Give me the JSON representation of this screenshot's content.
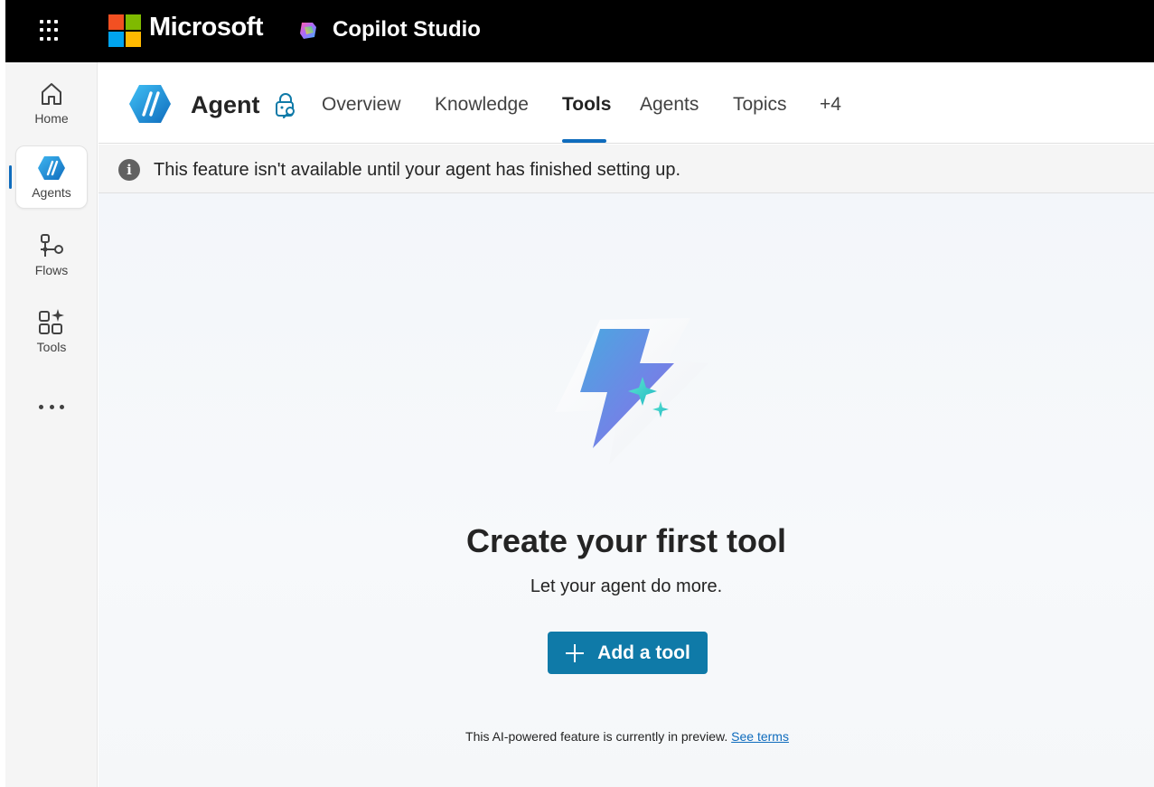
{
  "topbar": {
    "brand": "Microsoft",
    "product": "Copilot Studio",
    "waffle_icon": "app-launcher-icon",
    "brand_colors": [
      "#f25022",
      "#7fba00",
      "#00a4ef",
      "#ffb900"
    ]
  },
  "rail": {
    "items": [
      {
        "label": "Home",
        "icon": "home-icon"
      },
      {
        "label": "Agents",
        "icon": "agents-icon",
        "active": true
      },
      {
        "label": "Flows",
        "icon": "flows-icon"
      },
      {
        "label": "Tools",
        "icon": "tools-icon"
      }
    ],
    "more_icon": "more-icon"
  },
  "header": {
    "agent_name": "Agent",
    "tabs": [
      {
        "label": "Overview"
      },
      {
        "label": "Knowledge"
      },
      {
        "label": "Tools",
        "active": true
      },
      {
        "label": "Agents"
      },
      {
        "label": "Topics"
      },
      {
        "label": "+4"
      }
    ]
  },
  "banner": {
    "icon": "info-icon",
    "text": "This feature isn't available until your agent has finished setting up."
  },
  "main": {
    "title": "Create your first tool",
    "subtitle": "Let your agent do more.",
    "add_button": "Add a tool",
    "disclaimer": "This AI-powered feature is currently in preview.",
    "terms_link": "See terms"
  },
  "colors": {
    "accent": "#0f6cbd",
    "button": "#0f7aa8",
    "topbar": "#000000"
  }
}
